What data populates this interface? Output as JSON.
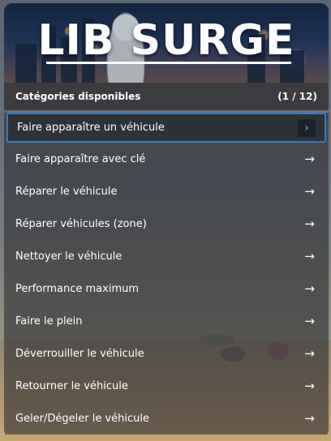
{
  "banner": {
    "title": "LIB SURGE"
  },
  "header": {
    "label": "Catégories disponibles",
    "counter": "(1 / 12)"
  },
  "items": [
    {
      "label": "Faire apparaître un véhicule",
      "icon": "chevron-right-icon",
      "selected": true
    },
    {
      "label": "Faire apparaître avec clé",
      "icon": "arrow-right-icon"
    },
    {
      "label": "Réparer le véhicule",
      "icon": "arrow-right-icon"
    },
    {
      "label": "Réparer véhicules (zone)",
      "icon": "arrow-right-icon"
    },
    {
      "label": "Nettoyer le véhicule",
      "icon": "arrow-right-icon"
    },
    {
      "label": "Performance maximum",
      "icon": "arrow-right-icon"
    },
    {
      "label": "Faire le plein",
      "icon": "arrow-right-icon"
    },
    {
      "label": "Déverrouiller le véhicule",
      "icon": "arrow-right-icon"
    },
    {
      "label": "Retourner le véhicule",
      "icon": "arrow-right-icon"
    },
    {
      "label": "Geler/Dégeler le véhicule",
      "icon": "arrow-right-icon"
    }
  ],
  "colors": {
    "accent": "#3478c6",
    "panel": "#3c3b3f",
    "text": "#ffffff"
  }
}
